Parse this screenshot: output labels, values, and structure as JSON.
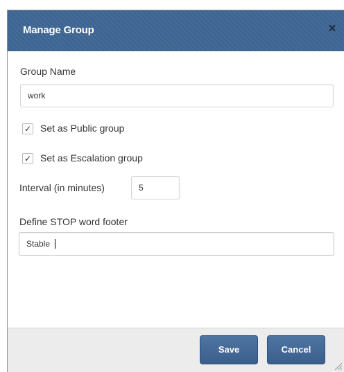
{
  "dialog": {
    "title": "Manage Group",
    "close_glyph": "×",
    "close_icon": "close-icon"
  },
  "form": {
    "group_name": {
      "label": "Group Name",
      "value": "work"
    },
    "public_group": {
      "label": "Set as Public group",
      "checked": true,
      "check_glyph": "✓"
    },
    "escalation_group": {
      "label": "Set as Escalation group",
      "checked": true,
      "check_glyph": "✓"
    },
    "interval": {
      "label": "Interval (in minutes)",
      "value": "5"
    },
    "stop_footer": {
      "label": "Define STOP word footer",
      "value": "Stable"
    }
  },
  "buttons": {
    "save": "Save",
    "cancel": "Cancel"
  },
  "colors": {
    "titlebar": "#3e6592",
    "button": "#44699a",
    "footer": "#ececec"
  }
}
